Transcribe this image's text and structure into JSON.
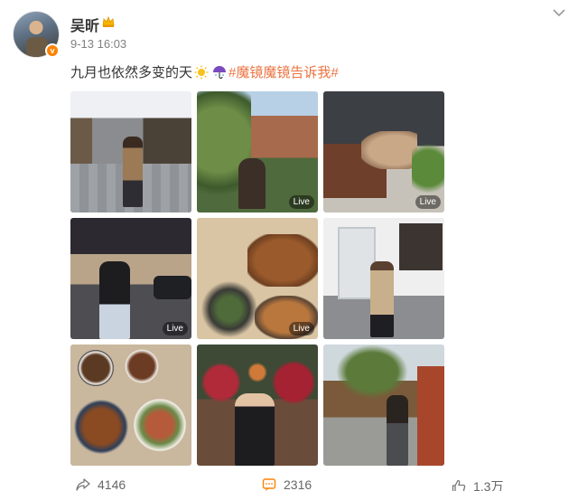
{
  "post": {
    "username": "吴昕",
    "timestamp": "9-13 16:03",
    "caption": {
      "text": "九月也依然多变的天",
      "hashtag": "#魔镜魔镜告诉我#"
    },
    "photos": [
      {
        "badge": ""
      },
      {
        "badge": "Live"
      },
      {
        "badge": "Live"
      },
      {
        "badge": "Live"
      },
      {
        "badge": "Live"
      },
      {
        "badge": ""
      },
      {
        "badge": ""
      },
      {
        "badge": ""
      },
      {
        "badge": ""
      }
    ],
    "actions": {
      "share_count": "4146",
      "comment_count": "2316",
      "like_count": "1.3万"
    }
  },
  "icons": [
    "verified-badge-icon",
    "crown-icon",
    "chevron-down-icon",
    "sun-emoji-icon",
    "umbrella-emoji-icon",
    "share-icon",
    "comment-icon",
    "like-icon"
  ],
  "colors": {
    "hashtag": "#eb7340",
    "username": "#333333",
    "meta": "#808080",
    "verified": "#ff8200",
    "comment_icon": "#ff8200"
  }
}
